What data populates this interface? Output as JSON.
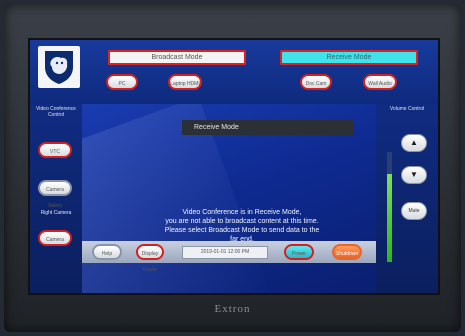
{
  "header": {
    "broadcast_tab": "Broadcast Mode",
    "receive_tab": "Receive Mode",
    "buttons": [
      "PC",
      "Laptop HDMI",
      "Doc Cam",
      "Wall Audio"
    ]
  },
  "left_panel": {
    "video_conference_label": "Video Conference Control",
    "buttons": [
      "VTC",
      "Camera Select"
    ],
    "right_camera_label": "Right Camera",
    "right_camera_button": "Camera"
  },
  "main": {
    "panel_title": "Receive Mode",
    "message_lines": [
      "Video Conference is in Receive Mode,",
      "you are not able to broadcast content at this time.",
      "Please select Broadcast Mode to send data to the",
      "far end."
    ]
  },
  "bottom_bar": {
    "help_button": "Help",
    "display_button": "Display Power",
    "datetime": "2019-01-01   12:00 PM",
    "power_button": "Power",
    "shutdown_button": "Shutdown"
  },
  "volume": {
    "label": "Volume Control",
    "up_icon": "▲",
    "down_icon": "▼",
    "mute_button": "Mute",
    "level": 0.8
  },
  "device": {
    "brand": "Extron"
  },
  "colors": {
    "accent_red": "#d42020",
    "active_tab": "#3fe3e9",
    "volume_green": "#29b81f"
  }
}
